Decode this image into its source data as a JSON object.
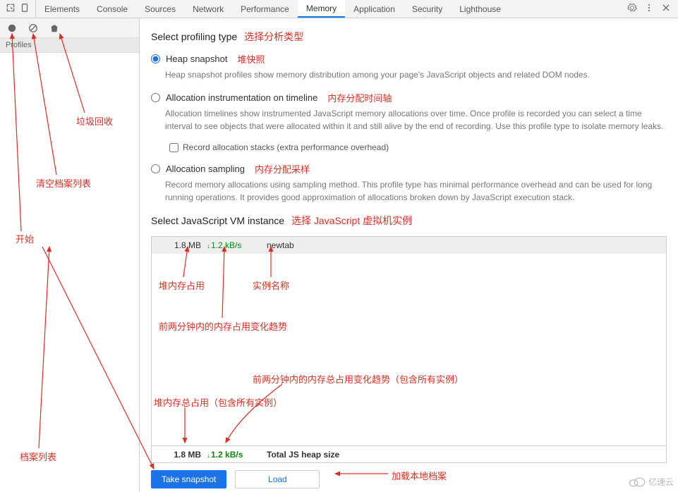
{
  "tabs": {
    "elements": "Elements",
    "console": "Console",
    "sources": "Sources",
    "network": "Network",
    "performance": "Performance",
    "memory": "Memory",
    "application": "Application",
    "security": "Security",
    "lighthouse": "Lighthouse"
  },
  "sidebar": {
    "profiles_label": "Profiles"
  },
  "profiling": {
    "title": "Select profiling type",
    "title_cn": "选择分析类型",
    "heap": {
      "label": "Heap snapshot",
      "label_cn": "堆快照",
      "desc": "Heap snapshot profiles show memory distribution among your page's JavaScript objects and related DOM nodes."
    },
    "alloc_timeline": {
      "label": "Allocation instrumentation on timeline",
      "label_cn": "内存分配时间轴",
      "desc": "Allocation timelines show instrumented JavaScript memory allocations over time. Once profile is recorded you can select a time interval to see objects that were allocated within it and still alive by the end of recording. Use this profile type to isolate memory leaks.",
      "checkbox": "Record allocation stacks (extra performance overhead)"
    },
    "alloc_sampling": {
      "label": "Allocation sampling",
      "label_cn": "内存分配采样",
      "desc": "Record memory allocations using sampling method. This profile type has minimal performance overhead and can be used for long running operations. It provides good approximation of allocations broken down by JavaScript execution stack."
    }
  },
  "vm": {
    "title": "Select JavaScript VM instance",
    "title_cn": "选择 JavaScript 虚拟机实例",
    "row": {
      "size": "1.8 MB",
      "rate": "1.2 kB/s",
      "name": "newtab"
    },
    "total": {
      "size": "1.8 MB",
      "rate": "1.2 kB/s",
      "label": "Total JS heap size"
    }
  },
  "buttons": {
    "take": "Take snapshot",
    "load": "Load"
  },
  "annotations": {
    "start": "开始",
    "clear": "清空档案列表",
    "gc": "垃圾回收",
    "profiles_list": "档案列表",
    "heap_usage": "堆内存占用",
    "trend_2min": "前两分钟内的内存占用变化趋势",
    "instance_name": "实例名称",
    "total_trend": "前两分钟内的内存总占用变化趋势（包含所有实例）",
    "total_heap": "堆内存总占用（包含所有实例）",
    "load_local": "加载本地档案"
  },
  "watermark": "亿速云"
}
